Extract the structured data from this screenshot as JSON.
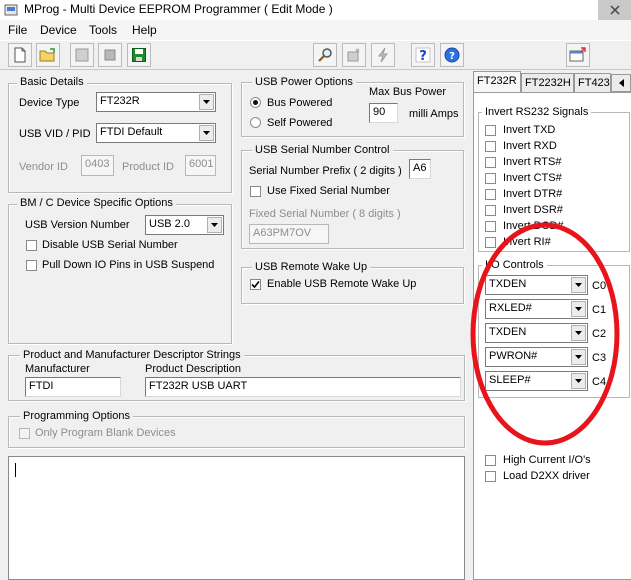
{
  "window": {
    "title": "MProg - Multi Device EEPROM Programmer ( Edit Mode )"
  },
  "menu": [
    "File",
    "Device",
    "Tools",
    "Help"
  ],
  "toolbar": {
    "icons": [
      "new-file-icon",
      "open-folder-icon",
      "erase-icon",
      "stop-icon",
      "save-icon",
      "search-icon",
      "scan-icon",
      "program-icon",
      "help-icon",
      "about-icon",
      "window-icon"
    ]
  },
  "basic_details": {
    "title": "Basic Details",
    "device_type_label": "Device Type",
    "device_type_value": "FT232R",
    "vid_pid_label": "USB VID / PID",
    "vid_pid_value": "FTDI Default",
    "vendor_id_label": "Vendor ID",
    "vendor_id_value": "0403",
    "product_id_label": "Product ID",
    "product_id_value": "6001"
  },
  "bm_options": {
    "title": "BM / C Device Specific Options",
    "usb_version_label": "USB Version Number",
    "usb_version_value": "USB 2.0",
    "disable_serial_label": "Disable USB Serial Number",
    "pull_down_label": "Pull Down IO Pins in USB Suspend"
  },
  "power": {
    "title": "USB Power Options",
    "bus_powered": "Bus Powered",
    "self_powered": "Self Powered",
    "max_bus_power_label": "Max Bus Power",
    "max_bus_power_value": "90",
    "unit": "milli Amps"
  },
  "serial_control": {
    "title": "USB Serial Number Control",
    "prefix_label": "Serial Number Prefix ( 2 digits )",
    "prefix_value": "A6",
    "use_fixed_label": "Use Fixed Serial Number",
    "fixed_label": "Fixed Serial Number ( 8 digits )",
    "fixed_value": "A63PM7OV"
  },
  "wake_up": {
    "title": "USB Remote Wake Up",
    "enable_label": "Enable USB Remote Wake Up"
  },
  "descriptors": {
    "title": "Product and Manufacturer Descriptor Strings",
    "manufacturer_label": "Manufacturer",
    "manufacturer_value": "FTDI",
    "product_label": "Product Description",
    "product_value": "FT232R USB UART"
  },
  "programming": {
    "title": "Programming Options",
    "blank_only_label": "Only Program Blank Devices"
  },
  "tabs": [
    "FT232R",
    "FT2232H",
    "FT423"
  ],
  "invert": {
    "title": "Invert RS232 Signals",
    "items": [
      "Invert TXD",
      "Invert RXD",
      "Invert RTS#",
      "Invert CTS#",
      "Invert DTR#",
      "Invert DSR#",
      "Invert DCD#",
      "Invert RI#"
    ]
  },
  "io_controls": {
    "title": "I/O Controls",
    "rows": [
      {
        "value": "TXDEN",
        "label": "C0"
      },
      {
        "value": "RXLED#",
        "label": "C1"
      },
      {
        "value": "TXDEN",
        "label": "C2"
      },
      {
        "value": "PWRON#",
        "label": "C3"
      },
      {
        "value": "SLEEP#",
        "label": "C4"
      }
    ]
  },
  "extra": {
    "high_current": "High Current I/O's",
    "load_d2xx": "Load D2XX driver"
  },
  "colors": {
    "annotation": "#e8141c",
    "accent_blue": "#2b5fd1",
    "save_green": "#1f8a2b"
  }
}
